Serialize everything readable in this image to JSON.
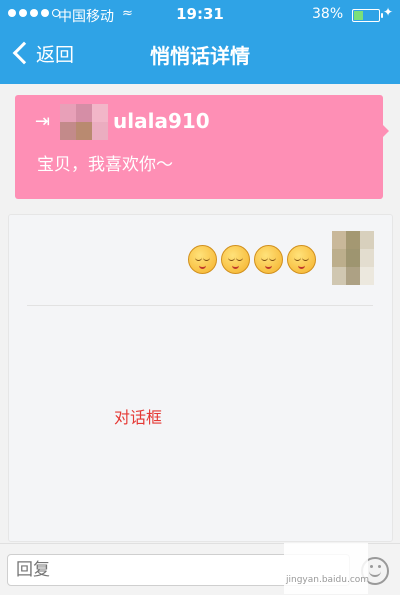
{
  "status_bar": {
    "carrier": "中国移动",
    "time": "19:31",
    "battery_percent": "38%",
    "battery_level": 0.38
  },
  "nav": {
    "back_label": "返回",
    "title": "悄悄话详情"
  },
  "message_card": {
    "username": "ulala910",
    "text": "宝贝，我喜欢你～",
    "background": "#fe8fb5"
  },
  "dialog": {
    "emoji_count": 4,
    "annotation": "对话框"
  },
  "reply": {
    "placeholder": "回复"
  },
  "colors": {
    "nav_blue": "#2fa3e6",
    "pink": "#fe8fb5",
    "annotation_red": "#e53935"
  }
}
